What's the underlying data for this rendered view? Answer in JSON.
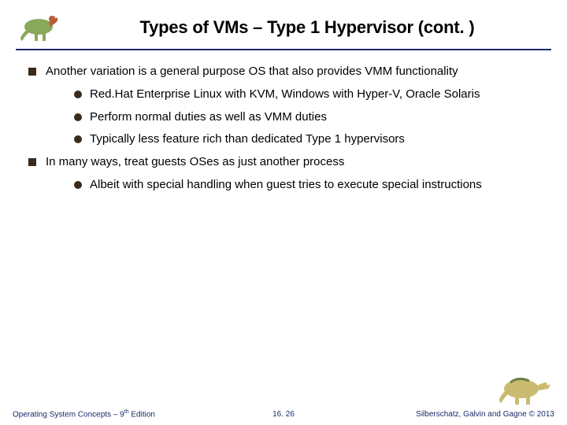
{
  "header": {
    "title": "Types of VMs – Type 1 Hypervisor (cont. )"
  },
  "bullets": {
    "b1": "Another variation is a general purpose OS that also provides VMM functionality",
    "b1_1": "Red.Hat Enterprise Linux with KVM, Windows with Hyper-V, Oracle Solaris",
    "b1_2": "Perform normal duties as well as VMM duties",
    "b1_3": "Typically less feature rich than dedicated Type 1 hypervisors",
    "b2": "In many ways, treat guests OSes as just another process",
    "b2_1": "Albeit with special handling when guest tries to execute special instructions"
  },
  "footer": {
    "left_prefix": "Operating System Concepts – 9",
    "left_sup": "th",
    "left_suffix": " Edition",
    "center": "16. 26",
    "right_prefix": "Silberschatz, Galvin and Gagne ",
    "right_suffix": "2013",
    "copyright": "©"
  }
}
